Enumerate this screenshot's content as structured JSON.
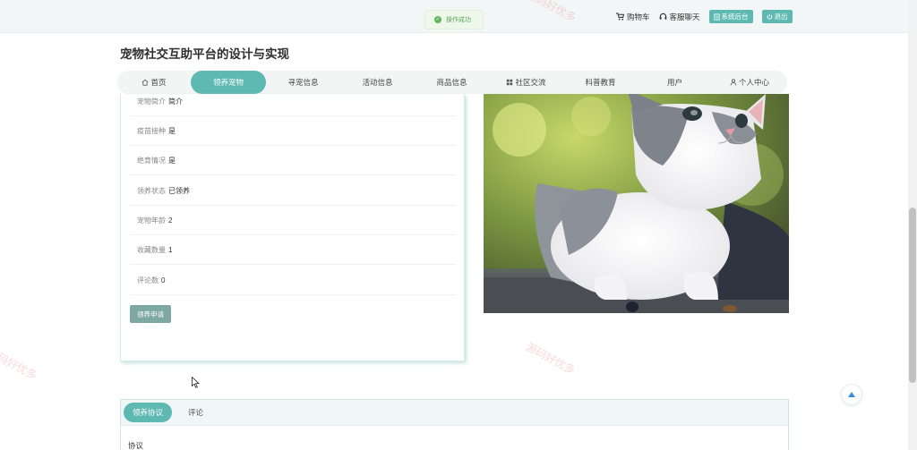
{
  "topbar": {
    "toast": "操作成功",
    "links": {
      "cart": "购物车",
      "service": "客服聊天",
      "admin": "系统后台",
      "logout": "退出"
    }
  },
  "site": {
    "title": "宠物社交互助平台的设计与实现"
  },
  "nav": {
    "items": [
      {
        "label": "首页",
        "icon": "home-icon"
      },
      {
        "label": "领养宠物",
        "active": true
      },
      {
        "label": "寻宠信息"
      },
      {
        "label": "活动信息"
      },
      {
        "label": "商品信息"
      },
      {
        "label": "社区交流",
        "icon": "grid-icon"
      },
      {
        "label": "科普教育"
      },
      {
        "label": "用户"
      },
      {
        "label": "个人中心",
        "icon": "user-icon"
      }
    ]
  },
  "details": {
    "rows": [
      {
        "label": "宠物简介",
        "value": "简介"
      },
      {
        "label": "疫苗接种",
        "value": "是"
      },
      {
        "label": "绝育情况",
        "value": "是"
      },
      {
        "label": "领养状态",
        "value": "已领养"
      },
      {
        "label": "宠物年龄",
        "value": "2"
      },
      {
        "label": "收藏数量",
        "value": "1"
      },
      {
        "label": "评论数",
        "value": "0"
      }
    ],
    "apply_label": "领养申请"
  },
  "watermarks": [
    "源码好优多"
  ],
  "tabs": {
    "items": [
      {
        "label": "领养协议",
        "active": true
      },
      {
        "label": "评论"
      }
    ],
    "content_heading": "协议"
  },
  "colors": {
    "accent": "#5eb9b2",
    "apply_button": "#7ea8a2",
    "toast_green": "#63b35f"
  }
}
